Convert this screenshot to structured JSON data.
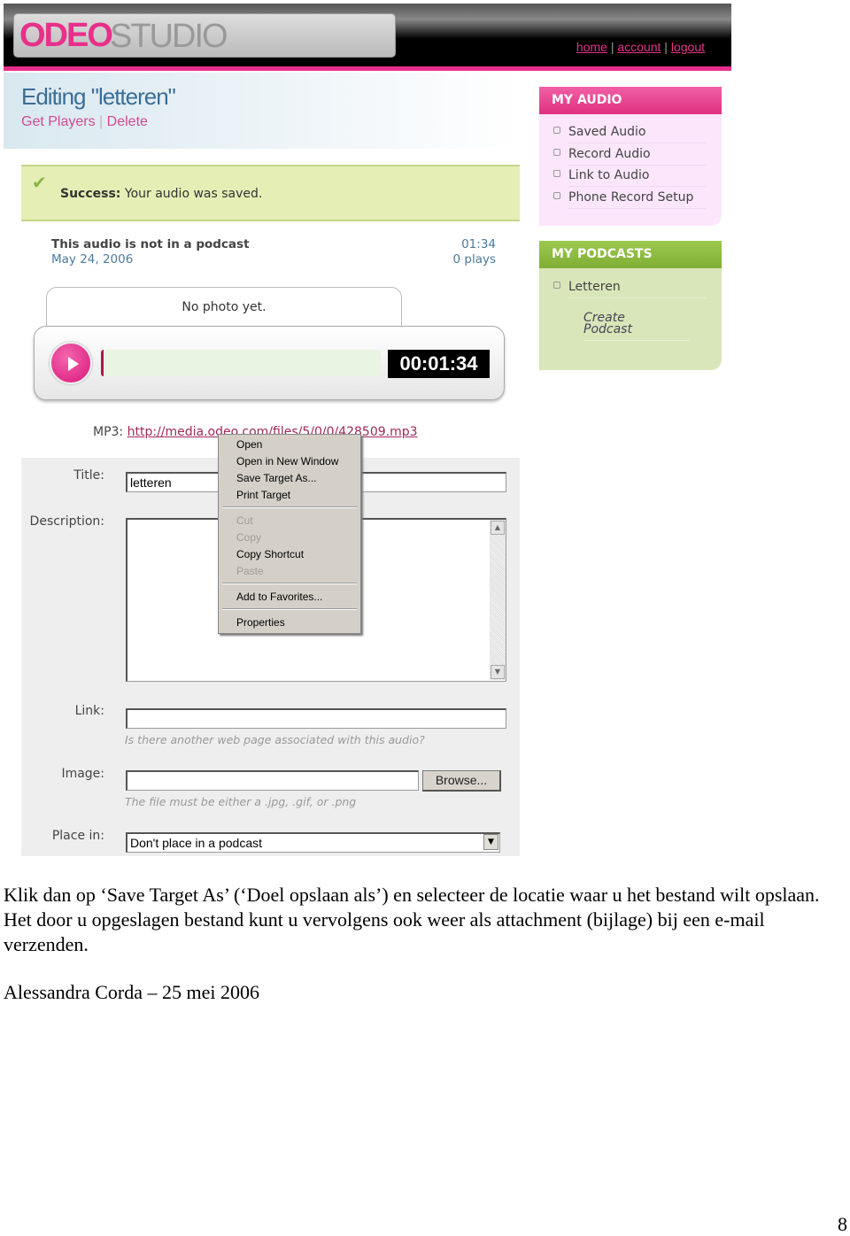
{
  "header": {
    "logo": "ODEO STUDIO",
    "logo_part1": "ODEO",
    "logo_part2": "STUDIO",
    "nav": [
      "home",
      "account",
      "logout"
    ]
  },
  "page": {
    "title": "Editing \"letteren\"",
    "links": [
      "Get Players",
      "Delete"
    ]
  },
  "success": {
    "label": "Success:",
    "message": " Your audio was saved."
  },
  "audio_info": {
    "podcast_status": "This audio is not in a podcast",
    "date": "May 24, 2006",
    "duration": "01:34",
    "plays": "0 plays"
  },
  "player": {
    "photo_text": "No photo yet.",
    "timer": "00:01:34",
    "progress": 0
  },
  "mp3": {
    "label": "MP3:",
    "url": "http://media.odeo.com/files/5/0/0/428509.mp3"
  },
  "form": {
    "title_label": "Title:",
    "title_value": "letteren",
    "description_label": "Description:",
    "description_value": "",
    "link_label": "Link:",
    "link_value": "",
    "link_hint": "Is there another web page associated with this audio?",
    "image_label": "Image:",
    "image_value": "",
    "browse_label": "Browse...",
    "image_hint": "The file must be either a .jpg, .gif, or .png",
    "place_label": "Place in:",
    "place_value": "Don't place in a podcast"
  },
  "context_menu": {
    "items": [
      {
        "label": "Open",
        "enabled": true
      },
      {
        "label": "Open in New Window",
        "enabled": true
      },
      {
        "label": "Save Target As...",
        "enabled": true
      },
      {
        "label": "Print Target",
        "enabled": true
      },
      {
        "label": "Cut",
        "enabled": false
      },
      {
        "label": "Copy",
        "enabled": false
      },
      {
        "label": "Copy Shortcut",
        "enabled": true
      },
      {
        "label": "Paste",
        "enabled": false
      },
      {
        "label": "Add to Favorites...",
        "enabled": true
      },
      {
        "label": "Properties",
        "enabled": true
      }
    ]
  },
  "sidebar": {
    "my_audio": {
      "title": "MY AUDIO",
      "items": [
        "Saved Audio",
        "Record Audio",
        "Link to Audio",
        "Phone Record Setup"
      ],
      "color": "#e8408f"
    },
    "my_podcasts": {
      "title": "MY PODCASTS",
      "items": [
        "Letteren"
      ],
      "create": "Create Podcast",
      "color": "#8ab83e"
    }
  },
  "document": {
    "paragraph": "Klik dan op ‘Save Target As’ (‘Doel opslaan als’) en selecteer de locatie waar u het bestand wilt opslaan. Het door u opgeslagen bestand kunt u vervolgens ook weer als attachment (bijlage) bij een e-mail verzenden.",
    "author": "Alessandra Corda – 25 mei 2006",
    "page_number": "8"
  }
}
